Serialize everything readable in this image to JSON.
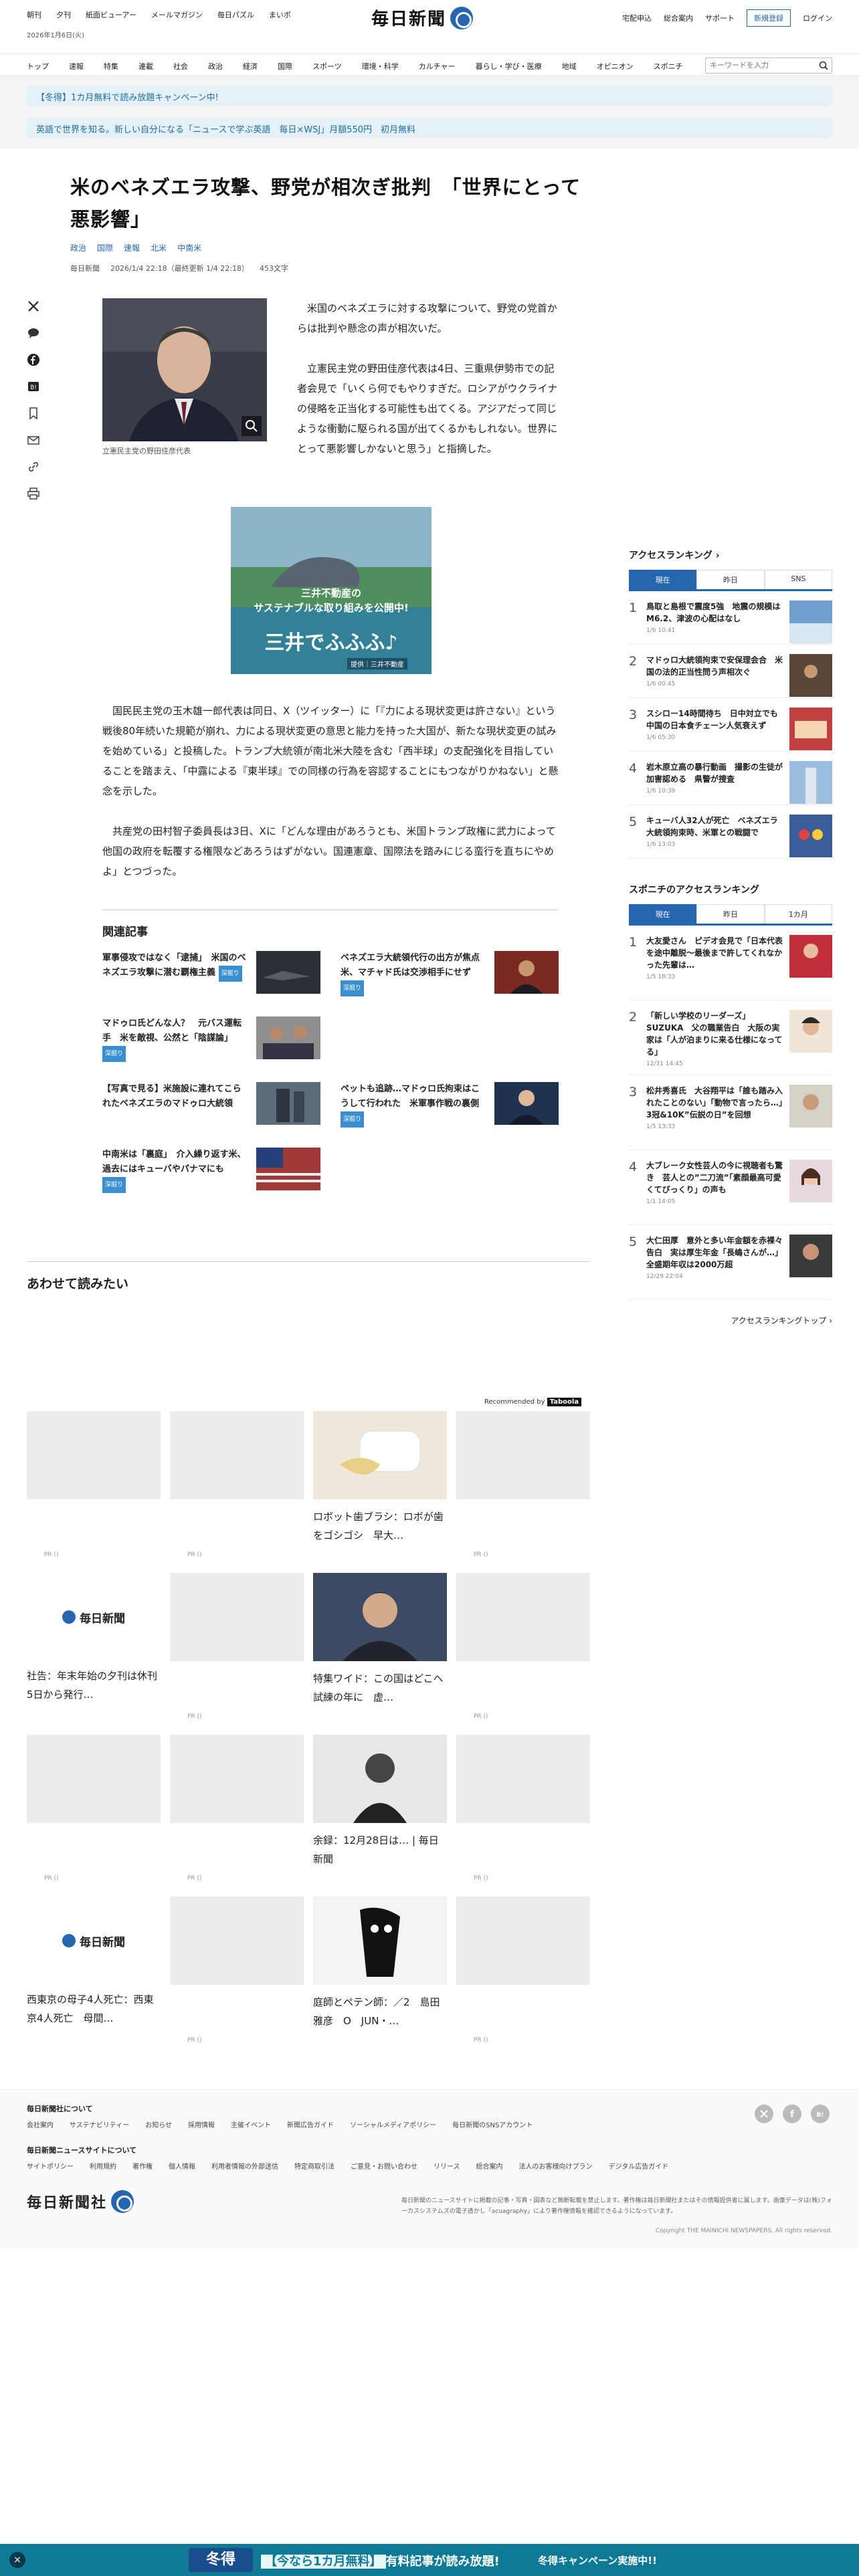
{
  "util": {
    "links": [
      "朝刊",
      "夕刊",
      "紙面ビューアー",
      "メールマガジン",
      "毎日パズル",
      "まいポ"
    ],
    "date": "2026年1月6日(火)",
    "logo": "毎日新聞",
    "right_links": [
      "宅配申込",
      "総合案内",
      "サポート"
    ],
    "register": "新規登録",
    "login": "ログイン"
  },
  "nav": {
    "items": [
      "トップ",
      "速報",
      "特集",
      "連載",
      "社会",
      "政治",
      "経済",
      "国際",
      "スポーツ",
      "環境・科学",
      "カルチャー",
      "暮らし・学び・医療",
      "地域",
      "オピニオン",
      "スポニチ"
    ],
    "search_placeholder": "キーワードを入力"
  },
  "promo": {
    "line1": "【冬得】1カ月無料で読み放題キャンペーン中!",
    "line2": "英語で世界を知る。新しい自分になる「ニュースで学ぶ英語　毎日×WSJ」月額550円　初月無料"
  },
  "article": {
    "headline": "米のベネズエラ攻撃、野党が相次ぎ批判　「世界にとって悪影響」",
    "tags": [
      "政治",
      "国際",
      "速報",
      "北米",
      "中南米"
    ],
    "source": "毎日新聞",
    "published": "2026/1/4 22:18（最終更新 1/4 22:18）",
    "chars": "453文字",
    "photo_caption": "立憲民主党の野田佳彦代表",
    "lead_paragraphs": [
      "米国のベネズエラに対する攻撃について、野党の党首からは批判や懸念の声が相次いだ。",
      "立憲民主党の野田佳彦代表は4日、三重県伊勢市での記者会見で「いくら何でもやりすぎだ。ロシアがウクライナの侵略を正当化する可能性も出てくる。アジアだって同じような衝動に駆られる国が出てくるかもしれない。世界にとって悪影響しかないと思う」と指摘した。"
    ],
    "body_paragraphs": [
      "国民民主党の玉木雄一郎代表は同日、X（ツイッター）に「『力による現状変更は許さない』という戦後80年続いた規範が崩れ、力による現状変更の意思と能力を持った大国が、新たな現状変更の試みを始めている」と投稿した。トランプ大統領が南北米大陸を含む「西半球」の支配強化を目指していることを踏まえ、「中露による『東半球』での同様の行為を容認することにもつながりかねない」と懸念を示した。",
      "共産党の田村智子委員長は3日、Xに「どんな理由があろうとも、米国トランプ政権に武力によって他国の政府を転覆する権限などあろうはずがない。国連憲章、国際法を踏みにじる蛮行を直ちにやめよ」とつづった。"
    ]
  },
  "ad": {
    "line1": "三井不動産の",
    "line2": "サステナブルな取り組みを公開中!",
    "brand": "三井でふふふ♪",
    "sponsor": "提供｜三井不動産"
  },
  "related": {
    "title": "関連記事",
    "items": [
      {
        "text": "軍事侵攻ではなく「逮捕」　米国のベネズエラ攻撃に潜む覇権主義",
        "badge": "深掘り"
      },
      {
        "text": "ベネズエラ大統領代行の出方が焦点　米、マチャド氏は交渉相手にせず",
        "badge": "深掘り"
      },
      {
        "text": "マドゥロ氏どんな人？　元バス運転手　米を敵視、公然と「陰謀論」",
        "badge": "深掘り"
      },
      {
        "text": "",
        "badge": ""
      },
      {
        "text": "【写真で見る】米施設に連れてこられたベネズエラのマドゥロ大統領",
        "badge": ""
      },
      {
        "text": "ペットも追跡…マドゥロ氏拘束はこうして行われた　米軍事作戦の裏側",
        "badge": "深掘り"
      },
      {
        "text": "中南米は「裏庭」　介入繰り返す米、過去にはキューバやパナマにも",
        "badge": "深掘り"
      }
    ]
  },
  "awase": {
    "title": "あわせて読みたい",
    "recommended_by": "Recommended by",
    "taboola": "Taboola"
  },
  "reco": {
    "pr": "PR ()",
    "cells": [
      {
        "label": ""
      },
      {
        "label": ""
      },
      {
        "label": "ロボット歯ブラシ：ロボが歯をゴシゴシ　早大…"
      },
      {
        "label": ""
      },
      {
        "label": "社告：年末年始の夕刊は休刊　5日から発行…"
      },
      {
        "label": ""
      },
      {
        "label": "特集ワイド：この国はどこへ　試練の年に　虚…"
      },
      {
        "label": ""
      },
      {
        "label": ""
      },
      {
        "label": ""
      },
      {
        "label": "余録：12月28日は… | 毎日新聞"
      },
      {
        "label": ""
      },
      {
        "label": "西東京の母子4人死亡：西東京4人死亡　母間…"
      },
      {
        "label": ""
      },
      {
        "label": "庭師とペテン師：／2　島田雅彦　O　JUN・…"
      },
      {
        "label": ""
      }
    ]
  },
  "ranking": {
    "title": "アクセスランキング",
    "tabs": [
      "現在",
      "昨日",
      "SNS"
    ],
    "items": [
      {
        "text": "鳥取と島根で震度5強　地震の規模はM6.2、津波の心配はなし",
        "time": "1/6 10:41"
      },
      {
        "text": "マドゥロ大統領拘束で安保理会合　米国の法的正当性問う声相次ぐ",
        "time": "1/6 00:45"
      },
      {
        "text": "スシロー14時間待ち　日中対立でも中国の日本食チェーン人気衰えず",
        "time": "1/6 05:30"
      },
      {
        "text": "岩木原立高の暴行動画　撮影の生徒が加害認める　県警が捜査",
        "time": "1/6 10:39"
      },
      {
        "text": "キューバ人32人が死亡　ベネズエラ大統領拘束時、米軍との戦闘で",
        "time": "1/6 13:03"
      }
    ],
    "sponichi_title": "スポニチのアクセスランキング",
    "sponichi_tabs": [
      "現在",
      "昨日",
      "1カ月"
    ],
    "sponichi_items": [
      {
        "text": "大友愛さん　ピデオ会見で「日本代表を途中離脱～最後まで許してくれなかった先輩は…",
        "time": "1/5 18:33"
      },
      {
        "text": "「新しい学校のリーダーズ」SUZUKA　父の職業告白　大阪の実家は「人が泊まりに来る仕様になってる」",
        "time": "12/31 14:45"
      },
      {
        "text": "松井秀喜氏　大谷翔平は「誰も踏み入れたことのない」「動物で言ったら…」3冠&10K”伝説の日”を回想",
        "time": "1/5 13:33"
      },
      {
        "text": "大ブレーク女性芸人の今に視聴者も驚き　芸人との”二刀流”「素顔最高可愛くてびっくり」の声も",
        "time": "1/1 14:05"
      },
      {
        "text": "大仁田厚　意外と多い年金額を赤裸々告白　実は厚生年金「長嶋さんが…」全盛期年収は2000万超",
        "time": "12/29 22:04"
      }
    ],
    "more": "アクセスランキングトップ"
  },
  "footer": {
    "about_title": "毎日新聞社について",
    "about_links": [
      "会社案内",
      "サステナビリティー",
      "お知らせ",
      "採用情報",
      "主催イベント",
      "新聞広告ガイド",
      "ソーシャルメディアポリシー",
      "毎日新聞のSNSアカウント"
    ],
    "site_title": "毎日新聞ニュースサイトについて",
    "site_links": [
      "サイトポリシー",
      "利用規約",
      "著作権",
      "個人情報",
      "利用者情報の外部送信",
      "特定商取引法",
      "ご意見・お問い合わせ",
      "リリース",
      "総合案内",
      "法人のお客様向けプラン",
      "デジタル広告ガイド"
    ],
    "logo": "毎日新聞社",
    "note": "毎日新聞のニュースサイトに掲載の記事・写真・図表など無断転載を禁止します。著作権は毎日新聞社またはその情報提供者に属します。画像データは(株)フォーカスシステムズの電子透かし「acuagraphy」により著作権情報を確認できるようになっています。",
    "copyright": "Copyright THE MAINICHI NEWSPAPERS. All rights reserved."
  },
  "bottom_banner": {
    "close": "×",
    "tag": "冬得",
    "main_highlight": "【今なら1カ月無料】",
    "main": "有料記事が読み放題!",
    "sub": "冬得キャンペーン実施中!!"
  }
}
